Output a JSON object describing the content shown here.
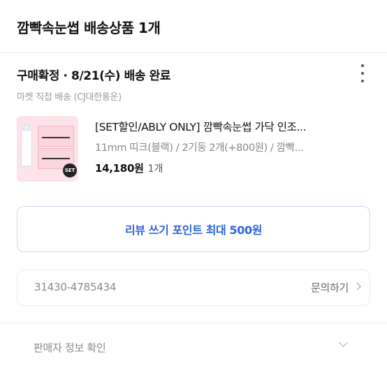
{
  "header": {
    "title": "깜빡속눈썹 배송상품 1개"
  },
  "order": {
    "status": "구매확정 · 8/21(수) 배송 완료",
    "shipping": "마켓 직접 배송 (CJ대한통운)"
  },
  "product": {
    "name": "[SET할인/ABLY ONLY] 깜빡속눈썹 가닥 인조...",
    "option": "11mm 띠크(블랙) / 2기둥 2개(+800원) / 깜빡...",
    "price": "14,180원",
    "quantity": "1개",
    "badge": "SET"
  },
  "review_button": {
    "label": "리뷰 쓰기 포인트 최대 500원"
  },
  "tracking": {
    "number": "31430-4785434",
    "inquiry_label": "문의하기"
  },
  "seller": {
    "label": "판매자 정보 확인"
  },
  "colors": {
    "accent": "#2e64d6",
    "text": "#111111",
    "muted": "#8a8a8a",
    "thumb_bg": "#fde3ea"
  },
  "icons": [
    "more-vertical-icon",
    "chevron-right-icon",
    "chevron-down-icon"
  ]
}
